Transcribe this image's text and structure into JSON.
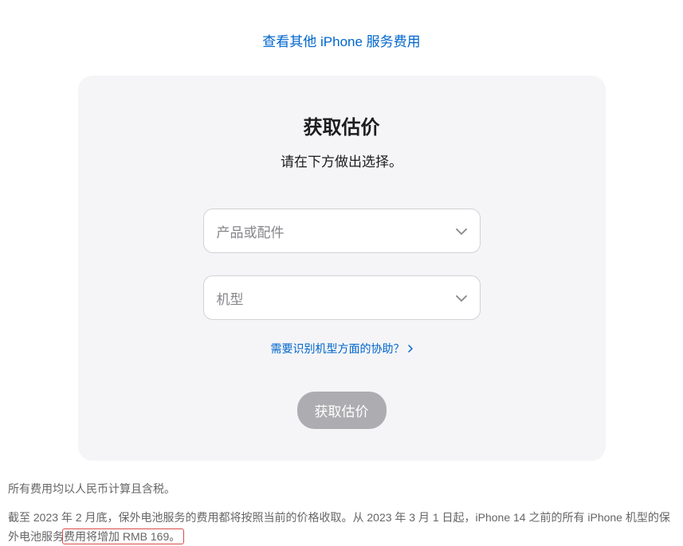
{
  "topLink": "查看其他 iPhone 服务费用",
  "card": {
    "title": "获取估价",
    "subtitle": "请在下方做出选择。",
    "select1Placeholder": "产品或配件",
    "select2Placeholder": "机型",
    "helpLink": "需要识别机型方面的协助？",
    "submitButton": "获取估价"
  },
  "footer": {
    "line1": "所有费用均以人民币计算且含税。",
    "line2a": "截至 2023 年 2 月底，保外电池服务的费用都将按照当前的价格收取。从 2023 年 3 月 1 日起，iPhone 14 之前的所有 iPhone 机型的保外电池服务",
    "line2b": "费用将增加 RMB 169。"
  }
}
